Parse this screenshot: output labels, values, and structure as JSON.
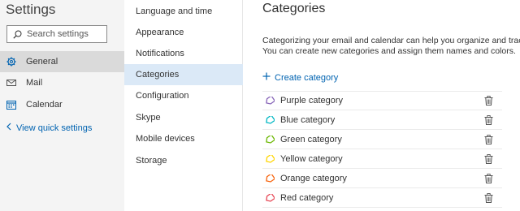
{
  "settings": {
    "title": "Settings",
    "search": {
      "placeholder": "Search settings"
    },
    "nav": [
      {
        "label": "General",
        "icon": "gear-icon",
        "selected": true
      },
      {
        "label": "Mail",
        "icon": "mail-icon",
        "selected": false
      },
      {
        "label": "Calendar",
        "icon": "calendar-icon",
        "selected": false
      }
    ],
    "quick_settings_link": "View quick settings"
  },
  "subnav": {
    "items": [
      {
        "label": "Language and time",
        "selected": false
      },
      {
        "label": "Appearance",
        "selected": false
      },
      {
        "label": "Notifications",
        "selected": false
      },
      {
        "label": "Categories",
        "selected": true
      },
      {
        "label": "Configuration",
        "selected": false
      },
      {
        "label": "Skype",
        "selected": false
      },
      {
        "label": "Mobile devices",
        "selected": false
      },
      {
        "label": "Storage",
        "selected": false
      }
    ]
  },
  "content": {
    "title": "Categories",
    "description_line1": "Categorizing your email and calendar can help you organize and track",
    "description_line2": "You can create new categories and assign them names and colors.",
    "create_label": "Create category",
    "categories": [
      {
        "name": "Purple category",
        "color": "#8764b8"
      },
      {
        "name": "Blue category",
        "color": "#00b7c3"
      },
      {
        "name": "Green category",
        "color": "#6bb700"
      },
      {
        "name": "Yellow category",
        "color": "#ffd500"
      },
      {
        "name": "Orange category",
        "color": "#f7630c"
      },
      {
        "name": "Red category",
        "color": "#e74856"
      }
    ]
  },
  "colors": {
    "accent": "#0063b1",
    "selected_subnav": "#dbe9f7",
    "selected_nav": "#dadada"
  }
}
